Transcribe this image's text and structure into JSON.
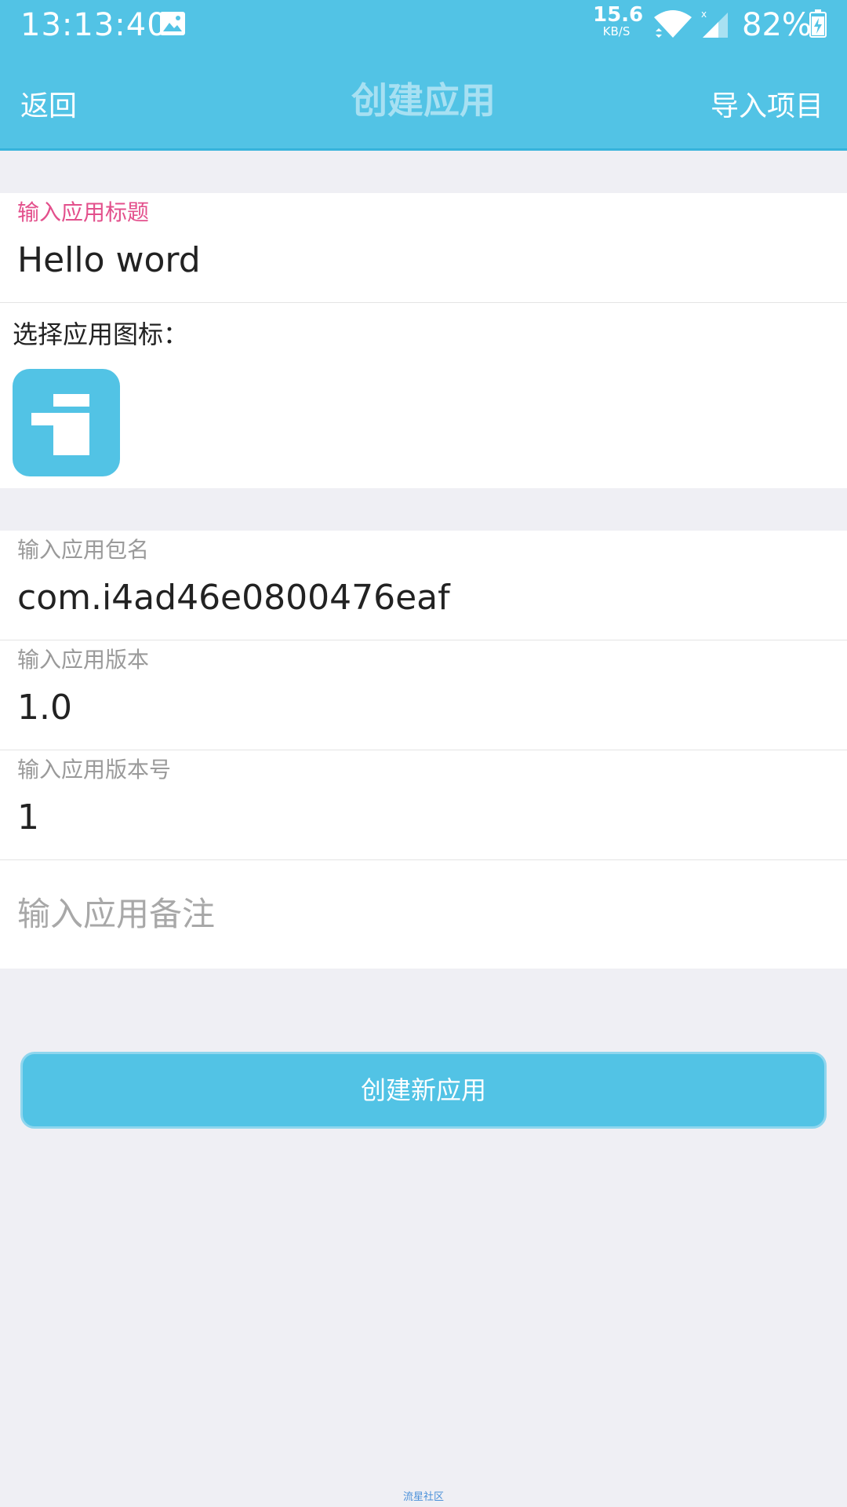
{
  "status_bar": {
    "time": "13:13:40",
    "net_speed_value": "15.6",
    "net_speed_unit": "KB/S",
    "battery": "82%",
    "icons": [
      "image-icon",
      "wifi-icon",
      "signal-icon",
      "battery-charging-icon"
    ]
  },
  "nav": {
    "back_label": "返回",
    "title": "创建应用",
    "import_label": "导入项目"
  },
  "form": {
    "title_field": {
      "label": "输入应用标题",
      "value": "Hello word"
    },
    "icon_chooser_label": "选择应用图标：",
    "package_field": {
      "label": "输入应用包名",
      "value": "com.i4ad46e0800476eaf"
    },
    "version_field": {
      "label": "输入应用版本",
      "value": "1.0"
    },
    "version_code_field": {
      "label": "输入应用版本号",
      "value": "1"
    },
    "remark_field": {
      "placeholder": "输入应用备注",
      "value": ""
    }
  },
  "actions": {
    "create_label": "创建新应用"
  },
  "footer": {
    "watermark": "流星社区"
  },
  "colors": {
    "accent": "#52c3e5",
    "active_label": "#e3508c",
    "background": "#efeff4"
  }
}
